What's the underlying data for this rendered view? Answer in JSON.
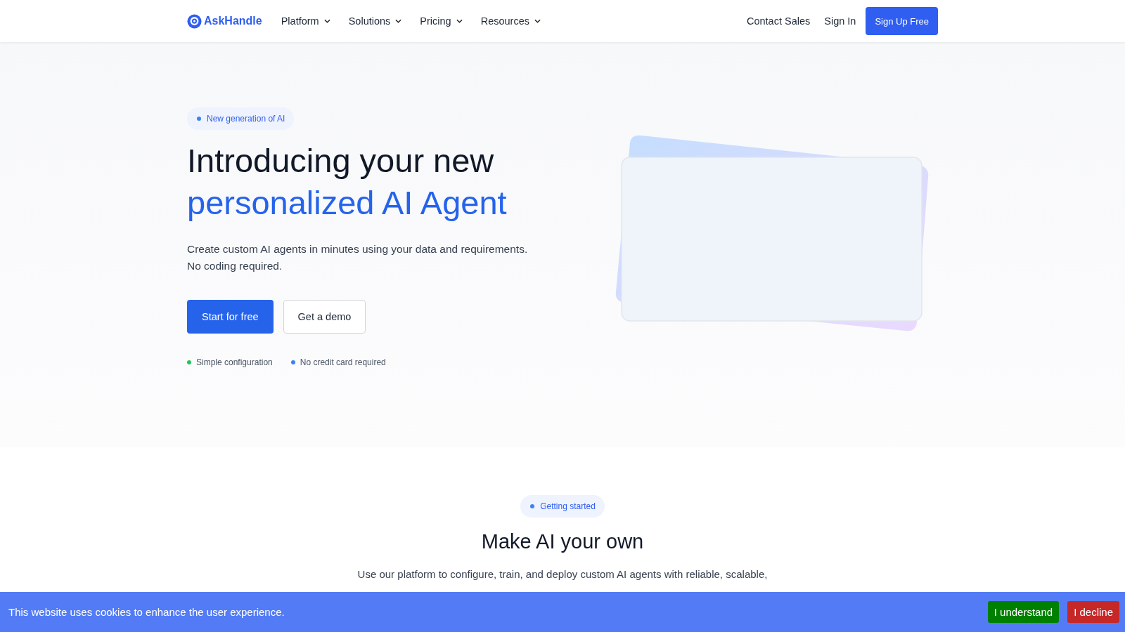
{
  "nav": {
    "logo": "AskHandle",
    "menu": [
      {
        "label": "Platform"
      },
      {
        "label": "Solutions"
      },
      {
        "label": "Pricing"
      },
      {
        "label": "Resources"
      }
    ],
    "links": [
      "Contact Sales",
      "Sign In"
    ],
    "cta": "Sign Up Free"
  },
  "hero": {
    "badge": "New generation of AI",
    "title_line1": "Introducing your new",
    "title_line2": "personalized AI Agent",
    "description": [
      "Create custom AI agents in minutes using your data and requirements.",
      "No coding required."
    ],
    "primary_button": "Start for free",
    "secondary_button": "Get a demo",
    "features": [
      {
        "text": "Simple configuration",
        "color": "#22c55e"
      },
      {
        "text": "No credit card required",
        "color": "#3b82f6"
      }
    ]
  },
  "section": {
    "badge": "Getting started",
    "title": "Make AI your own",
    "description": "Use our platform to configure, train, and deploy custom AI agents with reliable, scalable,"
  },
  "cookie_banner": {
    "message": "This website uses cookies to enhance the user experience.",
    "accept": "I understand",
    "decline": "I decline"
  }
}
